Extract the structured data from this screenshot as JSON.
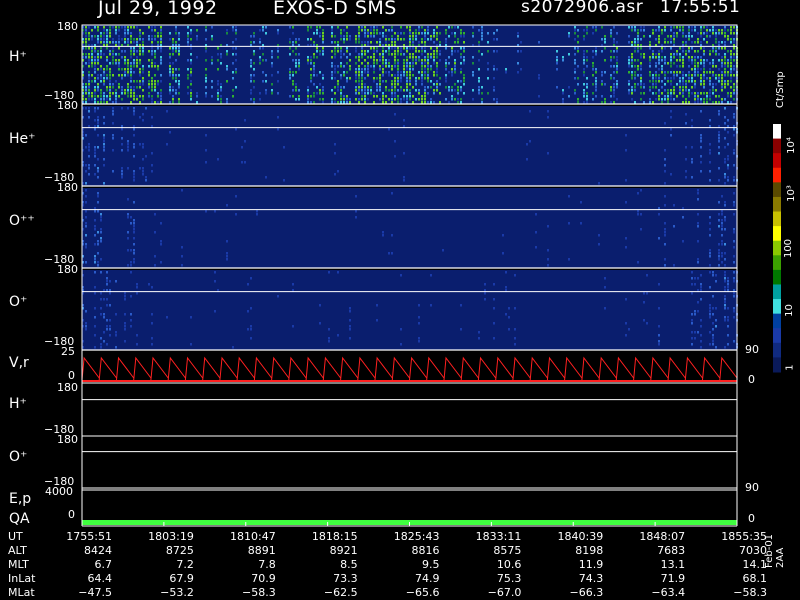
{
  "header": {
    "date": "Jul 29, 1992",
    "instrument": "EXOS-D SMS",
    "file": "s2072906.asr",
    "time": "17:55:51"
  },
  "colorbar": {
    "unit": "Ct/Smp",
    "ticks": [
      "10⁴",
      "10³",
      "100",
      "10",
      "1"
    ],
    "colors": [
      "#ffffff",
      "#8a0000",
      "#c40000",
      "#ff2000",
      "#5a4a00",
      "#8a7a00",
      "#c8c000",
      "#ffff00",
      "#8ac800",
      "#3ca000",
      "#007800",
      "#00a0a0",
      "#40e0e0",
      "#0040a0",
      "#1a3aa8",
      "#102a80",
      "#0a1a5a"
    ]
  },
  "footer_note": "Feb-01 2AA",
  "chart_data": [
    {
      "type": "heatmap",
      "panel": "H+",
      "ylabel": "H⁺",
      "yticks": [
        "180",
        "−180"
      ],
      "ylim": [
        -180,
        180
      ],
      "reference_line": 90,
      "activity": [
        0.95,
        0.9,
        0.85,
        0.7,
        0.6,
        0.55,
        0.5,
        0.6,
        0.7,
        0.75,
        0.9,
        0.95,
        0.85,
        0.7,
        0.5,
        0.35,
        0.2,
        0.4,
        0.55,
        0.65,
        0.75,
        0.85,
        0.9,
        0.95
      ]
    },
    {
      "type": "heatmap",
      "panel": "He+",
      "ylabel": "He⁺",
      "yticks": [
        "180",
        "−180"
      ],
      "ylim": [
        -180,
        180
      ],
      "reference_line": 90,
      "activity": [
        0.55,
        0.45,
        0.25,
        0.15,
        0.12,
        0.1,
        0.1,
        0.12,
        0.1,
        0.12,
        0.15,
        0.15,
        0.12,
        0.12,
        0.1,
        0.1,
        0.12,
        0.15,
        0.12,
        0.12,
        0.2,
        0.3,
        0.45,
        0.55
      ]
    },
    {
      "type": "heatmap",
      "panel": "O++",
      "ylabel": "O⁺⁺",
      "yticks": [
        "180",
        "−180"
      ],
      "ylim": [
        -180,
        180
      ],
      "reference_line": 90,
      "activity": [
        0.5,
        0.35,
        0.2,
        0.12,
        0.1,
        0.1,
        0.1,
        0.1,
        0.1,
        0.1,
        0.12,
        0.12,
        0.1,
        0.1,
        0.1,
        0.1,
        0.1,
        0.12,
        0.12,
        0.15,
        0.2,
        0.3,
        0.4,
        0.5
      ]
    },
    {
      "type": "heatmap",
      "panel": "O+",
      "ylabel": "O⁺",
      "yticks": [
        "180",
        "−180"
      ],
      "ylim": [
        -180,
        180
      ],
      "reference_line": 90,
      "activity": [
        0.5,
        0.3,
        0.18,
        0.12,
        0.12,
        0.12,
        0.12,
        0.12,
        0.12,
        0.15,
        0.15,
        0.12,
        0.12,
        0.12,
        0.15,
        0.2,
        0.12,
        0.12,
        0.12,
        0.15,
        0.2,
        0.3,
        0.4,
        0.5
      ]
    },
    {
      "type": "line",
      "panel": "V,r",
      "ylabel": "V,r",
      "yticks_left": [
        "25",
        "0"
      ],
      "yticks_right": [
        "90",
        "0"
      ],
      "ylim": [
        0,
        25
      ],
      "pattern": "sawtooth",
      "cycles": 38,
      "color": "#ff2020"
    },
    {
      "type": "line",
      "panel": "H+ (lower)",
      "ylabel": "H⁺",
      "yticks": [
        "180",
        "−180"
      ],
      "ylim": [
        -180,
        180
      ],
      "reference_line": 90
    },
    {
      "type": "line",
      "panel": "O+ (lower)",
      "ylabel": "O⁺",
      "yticks": [
        "180",
        "−180"
      ],
      "ylim": [
        -180,
        180
      ],
      "reference_line": 90
    },
    {
      "type": "line",
      "panel": "E,p / QA",
      "ylabel_top": "E,p",
      "ylabel_bottom": "QA",
      "yticks_left": [
        "4000",
        "0"
      ],
      "yticks_right": [
        "90",
        "0"
      ],
      "ylim": [
        0,
        4000
      ],
      "qa_color": "#40ff40"
    },
    {
      "type": "table",
      "rows": [
        {
          "label": "UT",
          "values": [
            "1755:51",
            "1803:19",
            "1810:47",
            "1818:15",
            "1825:43",
            "1833:11",
            "1840:39",
            "1848:07",
            "1855:35"
          ]
        },
        {
          "label": "ALT",
          "values": [
            "8424",
            "8725",
            "8891",
            "8921",
            "8816",
            "8575",
            "8198",
            "7683",
            "7030"
          ]
        },
        {
          "label": "MLT",
          "values": [
            "6.7",
            "7.2",
            "7.8",
            "8.5",
            "9.5",
            "10.6",
            "11.9",
            "13.1",
            "14.1"
          ]
        },
        {
          "label": "InLat",
          "values": [
            "64.4",
            "67.9",
            "70.9",
            "73.3",
            "74.9",
            "75.3",
            "74.3",
            "71.9",
            "68.1"
          ]
        },
        {
          "label": "MLat",
          "values": [
            "−47.5",
            "−53.2",
            "−58.3",
            "−62.5",
            "−65.6",
            "−67.0",
            "−66.3",
            "−63.4",
            "−58.3"
          ]
        }
      ]
    }
  ]
}
